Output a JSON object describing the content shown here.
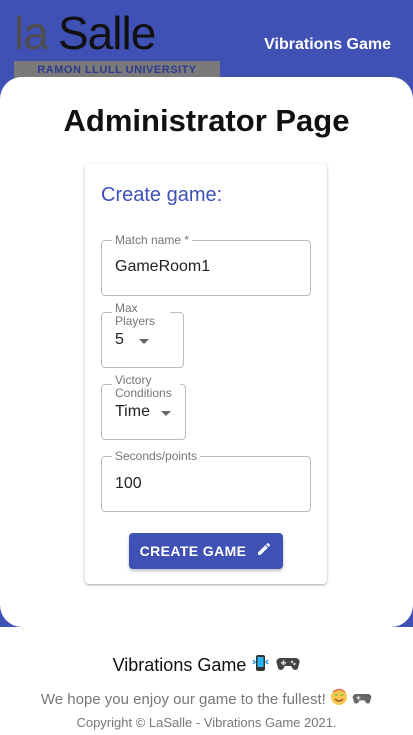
{
  "header": {
    "logo_la": "la",
    "logo_salle": "Salle",
    "logo_band": "RAMON LLULL UNIVERSITY",
    "title": "Vibrations Game"
  },
  "page": {
    "title": "Administrator Page"
  },
  "form": {
    "title": "Create game:",
    "match_name": {
      "label": "Match name *",
      "value": "GameRoom1"
    },
    "max_players": {
      "label": "Max Players",
      "value": "5"
    },
    "victory_conditions": {
      "label": "Victory Conditions",
      "value": "Time"
    },
    "seconds_points": {
      "label": "Seconds/points",
      "value": "100"
    },
    "create_button": "CREATE GAME"
  },
  "footer": {
    "title": "Vibrations Game",
    "message": "We hope you enjoy our game to the fullest!",
    "copyright": "Copyright © LaSalle - Vibrations Game 2021."
  },
  "colors": {
    "primary": "#3f51b5"
  },
  "icons": [
    "pencil-icon",
    "phone-vibrate-icon",
    "gamepad-icon",
    "smile-emoji-icon"
  ]
}
